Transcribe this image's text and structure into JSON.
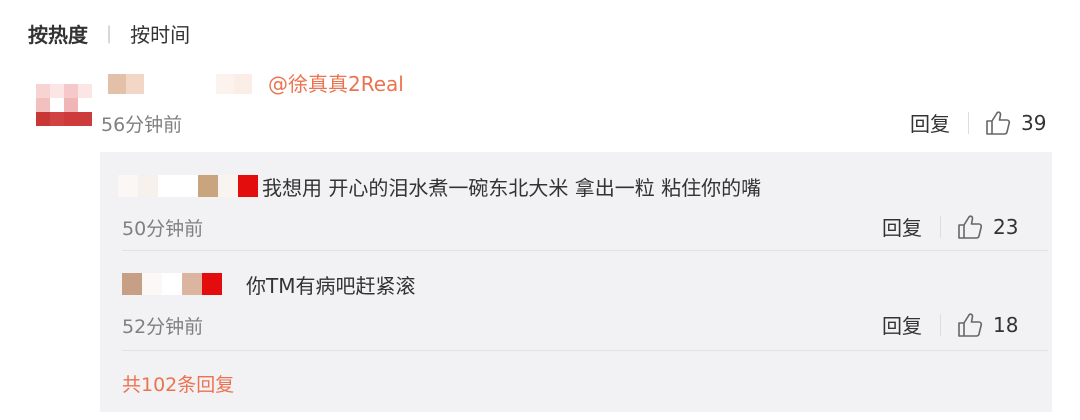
{
  "sort": {
    "active": "按热度",
    "other": "按时间"
  },
  "main_comment": {
    "mention": "@徐真真2Real",
    "time": "56分钟前",
    "reply_label": "回复",
    "likes": "39",
    "avatar_colors": [
      "#ffffff",
      "#ffffff",
      "#ffffff",
      "#ffffff",
      "#f7d4d4",
      "#fbe5e5",
      "#f5c9c9",
      "#fbe5e5",
      "#f3c0c0",
      "#ffffff",
      "#f0b6b6",
      "#ffffff",
      "#c93636",
      "#d14242",
      "#cf3a3a",
      "#cd3c3c"
    ],
    "name_blur_colors": [
      "#e3c1a8",
      "#f2d6c6",
      "#ffffff",
      "#ffffff",
      "#ffffff",
      "#ffffff",
      "#fdf3ee",
      "#fbeee6"
    ]
  },
  "replies": [
    {
      "text": "我想用 开心的泪水煮一碗东北大米 拿出一粒 粘住你的嘴",
      "time": "50分钟前",
      "reply_label": "回复",
      "likes": "23",
      "blur_colors": [
        "#fbf7f4",
        "#f7f1ee",
        "#ffffff",
        "#ffffff",
        "#c8a57e",
        "#f9f4f0",
        "#e30d0d"
      ]
    },
    {
      "text": "你TM有病吧赶紧滚",
      "time": "52分钟前",
      "reply_label": "回复",
      "likes": "18",
      "blur_colors": [
        "#c69f85",
        "#fcf8f5",
        "#ffffff",
        "#dcb5a0",
        "#e30d0d"
      ]
    }
  ],
  "total_replies": "共102条回复"
}
